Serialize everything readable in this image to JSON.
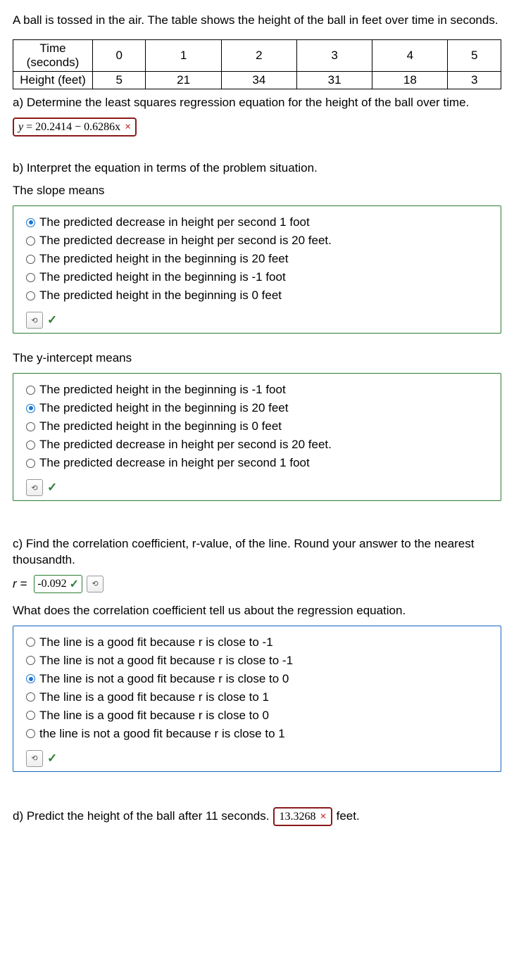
{
  "intro": "A ball is tossed in the air. The table shows the height of the ball in feet over time in seconds.",
  "table": {
    "row1_label": "Time (seconds)",
    "row2_label": "Height (feet)",
    "cols": [
      "0",
      "1",
      "2",
      "3",
      "4",
      "5"
    ],
    "vals": [
      "5",
      "21",
      "34",
      "31",
      "18",
      "3"
    ]
  },
  "a": {
    "prompt": "a) Determine the least squares regression equation for the height of the ball over time.",
    "answer_lhs": "y",
    "answer_rhs": "20.2414 − 0.6286x",
    "mark": "×"
  },
  "b": {
    "prompt": "b) Interpret the equation in terms of the problem situation.",
    "slope_label": "The slope means",
    "slope_options": [
      {
        "text": "The predicted decrease in height per second 1 foot",
        "selected": true
      },
      {
        "text": "The predicted decrease in height per second is 20 feet.",
        "selected": false
      },
      {
        "text": "The predicted height in the beginning is 20 feet",
        "selected": false
      },
      {
        "text": "The predicted height in the beginning is -1 foot",
        "selected": false
      },
      {
        "text": "The predicted height in the beginning is 0 feet",
        "selected": false
      }
    ],
    "yint_label": "The y-intercept means",
    "yint_options": [
      {
        "text": "The predicted height in the beginning is -1 foot",
        "selected": false
      },
      {
        "text": "The predicted height in the beginning is 20 feet",
        "selected": true
      },
      {
        "text": "The predicted height in the beginning is 0 feet",
        "selected": false
      },
      {
        "text": "The predicted decrease in height per second is 20 feet.",
        "selected": false
      },
      {
        "text": "The predicted decrease in height per second 1 foot",
        "selected": false
      }
    ],
    "check": "✓"
  },
  "c": {
    "prompt": "c) Find the correlation coefficient, r-value, of the line. Round your answer to the nearest thousandth.",
    "label": "r =",
    "value": "-0.092",
    "check": "✓",
    "sub_prompt": "What does the correlation coefficient tell us about the regression equation.",
    "options": [
      {
        "text": "The line is a good fit because r is close to -1",
        "selected": false
      },
      {
        "text": "The line is not a good fit because r is close to -1",
        "selected": false
      },
      {
        "text": "The line is not a good fit because r is close to 0",
        "selected": true
      },
      {
        "text": "The line is a good fit because r is close to 1",
        "selected": false
      },
      {
        "text": "The line is a good fit because r is close to 0",
        "selected": false
      },
      {
        "text": "the line is not a good fit because r is close to 1",
        "selected": false
      }
    ]
  },
  "d": {
    "prompt": "d) Predict the height of the ball after 11 seconds.",
    "value": "13.3268",
    "mark": "×",
    "suffix": "feet."
  },
  "icons": {
    "retry": "⟲"
  }
}
